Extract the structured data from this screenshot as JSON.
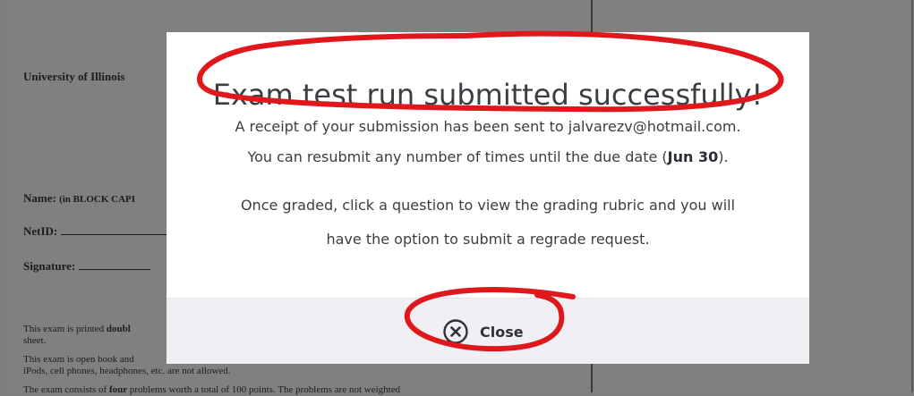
{
  "background_doc": {
    "university": "University of Illinois",
    "name_label": "Name:",
    "name_hint": "(in BLOCK CAPI",
    "netid_label": "NetID:",
    "signature_label": "Signature:",
    "para1_start": "This exam is printed",
    "para1_bold": "doubl",
    "para1_end": "sheet.",
    "para2_line1": "This exam is open book and",
    "para2_line2": "iPods, cell phones, headphones, etc. are not allowed.",
    "para3_start": "The exam consists of",
    "para3_bold": "four",
    "para3_end": "problems worth a total of 100 points. The problems are not weighted"
  },
  "modal": {
    "title": "Exam test run submitted successfully!",
    "receipt_text": "A receipt of your submission has been sent to jalvarezv@hotmail.com.",
    "resubmit_prefix": "You can resubmit any number of times until the due date (",
    "due_date": "Jun 30",
    "resubmit_suffix": ").",
    "graded_line1": "Once graded, click a question to view the grading rubric and you will",
    "graded_line2": "have the option to submit a regrade request.",
    "close_label": "Close",
    "close_icon": "close-circle-icon"
  },
  "colors": {
    "overlay": "#7e7e7e",
    "modal_bg": "#ffffff",
    "footer_bg": "#f0eff4",
    "annotation": "#e0181b",
    "text": "#3a3d42"
  }
}
